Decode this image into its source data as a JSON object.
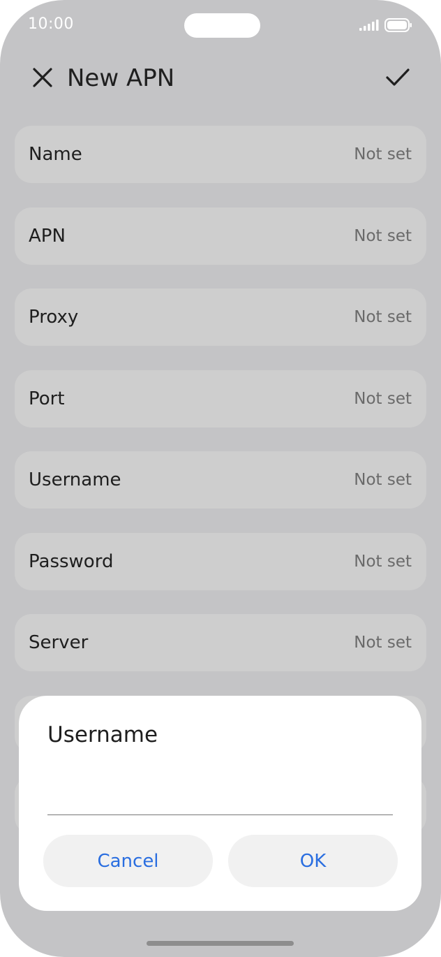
{
  "status_bar": {
    "time": "10:00"
  },
  "header": {
    "title": "New APN",
    "close_icon": "close-icon",
    "confirm_icon": "check-icon"
  },
  "apn_fields": [
    {
      "label": "Name",
      "value": "Not set"
    },
    {
      "label": "APN",
      "value": "Not set"
    },
    {
      "label": "Proxy",
      "value": "Not set"
    },
    {
      "label": "Port",
      "value": "Not set"
    },
    {
      "label": "Username",
      "value": "Not set"
    },
    {
      "label": "Password",
      "value": "Not set"
    },
    {
      "label": "Server",
      "value": "Not set"
    }
  ],
  "dialog": {
    "title": "Username",
    "input_value": "",
    "cancel_label": "Cancel",
    "ok_label": "OK"
  },
  "colors": {
    "accent": "#2a6ee0",
    "scrim_background": "#c4c4c6",
    "row_background": "#cecece"
  }
}
